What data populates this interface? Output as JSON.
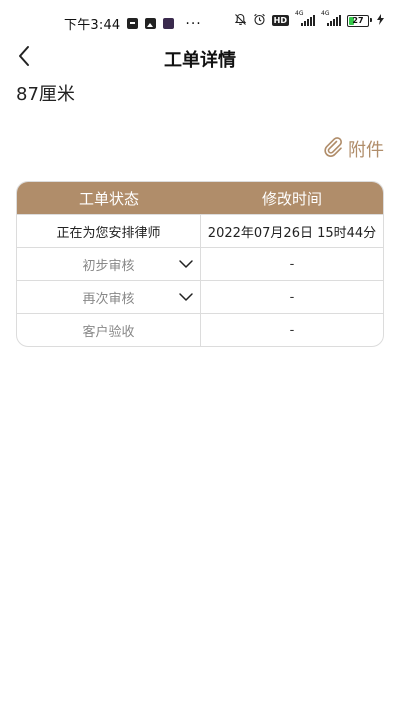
{
  "status_bar": {
    "time": "下午3:44",
    "more": "···",
    "hd": "HD",
    "net1": "4G",
    "net2": "4G",
    "battery_level": "27",
    "battery_fraction": 0.27
  },
  "nav": {
    "title": "工单详情"
  },
  "subject": "87厘米",
  "attachment": {
    "label": "附件"
  },
  "table": {
    "headers": [
      "工单状态",
      "修改时间"
    ],
    "rows": [
      {
        "status": "正在为您安排律师",
        "time": "2022年07月26日 15时44分",
        "expandable": false
      },
      {
        "status": "初步审核",
        "time": "-",
        "expandable": true
      },
      {
        "status": "再次审核",
        "time": "-",
        "expandable": true
      },
      {
        "status": "客户验收",
        "time": "-",
        "expandable": false
      }
    ]
  },
  "colors": {
    "accent": "#b08d6a",
    "border": "#dcdcdc",
    "battery": "#35c84a"
  },
  "icons": {
    "back": "chevron-left-icon",
    "attachment": "paperclip-icon",
    "expand": "chevron-down-icon"
  }
}
